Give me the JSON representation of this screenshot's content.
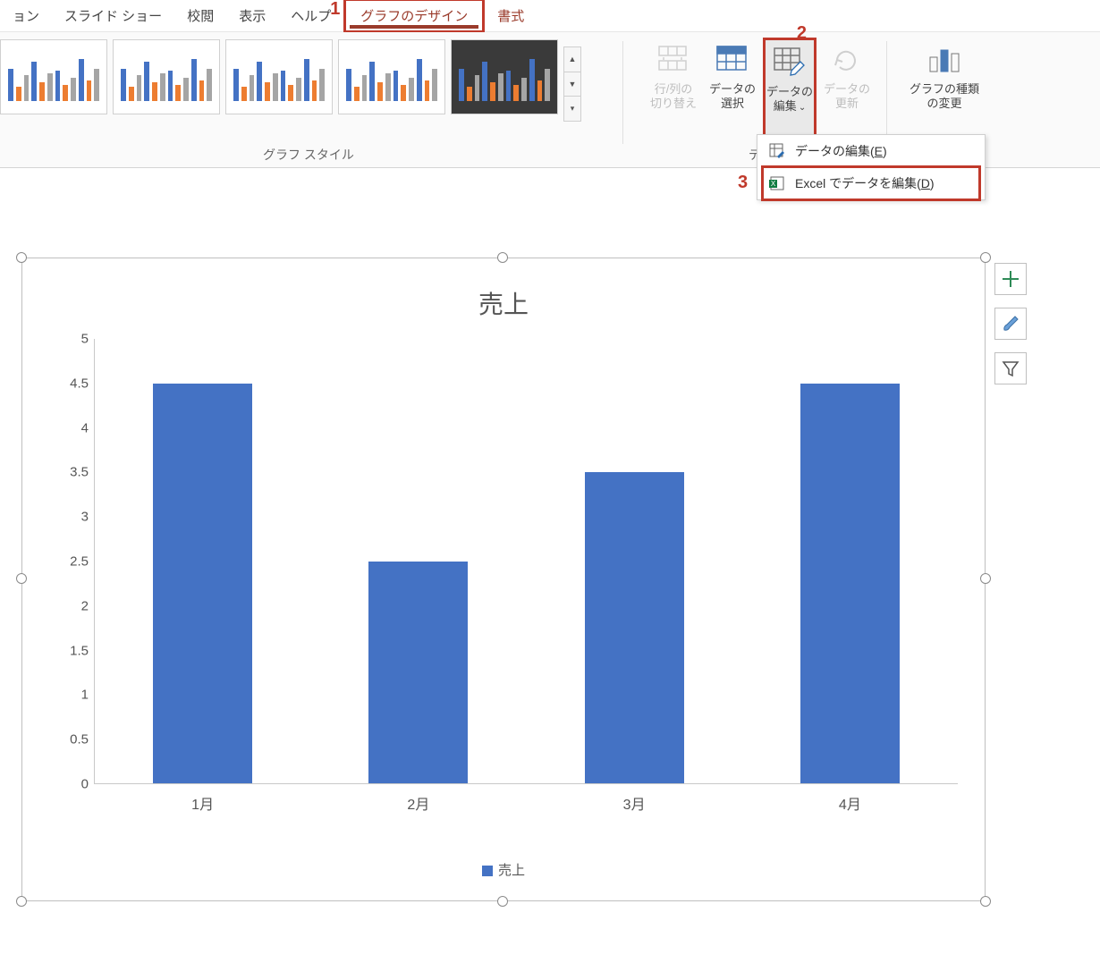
{
  "callouts": {
    "1": "1",
    "2": "2",
    "3": "3"
  },
  "ribbon_tabs": {
    "partial": "ョン",
    "slideshow": "スライド ショー",
    "review": "校閲",
    "view": "表示",
    "help": "ヘルプ",
    "chart_design": "グラフのデザイン",
    "format": "書式"
  },
  "ribbon": {
    "group_styles_label": "グラフ スタイル",
    "group_data_label_partial": "デ",
    "buttons": {
      "switch_rc_l1": "行/列の",
      "switch_rc_l2": "切り替え",
      "select_data_l1": "データの",
      "select_data_l2": "選択",
      "edit_data_l1": "データの",
      "edit_data_l2": "編集",
      "refresh_l1": "データの",
      "refresh_l2": "更新",
      "change_type_l1": "グラフの種類",
      "change_type_l2": "の変更"
    },
    "dropdown_caret": "⌄"
  },
  "edit_menu": {
    "edit_data": {
      "text_pre": "データの編集(",
      "accel": "E",
      "text_post": ")"
    },
    "edit_in_excel": {
      "text_pre": "Excel でデータを編集(",
      "accel": "D",
      "text_post": ")"
    }
  },
  "chart_data": {
    "type": "bar",
    "title": "売上",
    "categories": [
      "1月",
      "2月",
      "3月",
      "4月"
    ],
    "values": [
      4.5,
      2.5,
      3.5,
      4.5
    ],
    "series_name": "売上",
    "ylim": [
      0,
      5
    ],
    "ystep": 0.5,
    "y_ticks": [
      "0",
      "0.5",
      "1",
      "1.5",
      "2",
      "2.5",
      "3",
      "3.5",
      "4",
      "4.5",
      "5"
    ],
    "bar_color": "#4472c4"
  },
  "side_buttons": {
    "plus": "chart-elements",
    "brush": "chart-styles",
    "funnel": "chart-filter"
  }
}
